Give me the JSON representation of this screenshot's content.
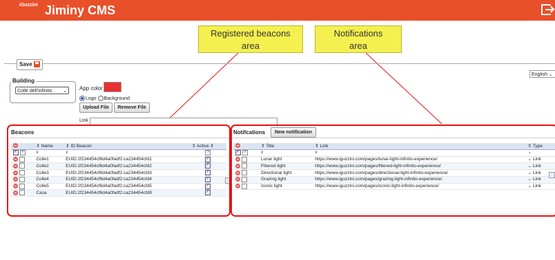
{
  "header": {
    "brand_small": "iGuzzini",
    "title": "Jiminy CMS",
    "exit_icon": "logout-icon"
  },
  "annotations": {
    "beacons_callout": [
      "Registered beacons",
      "area"
    ],
    "notifications_callout": [
      "Notifications",
      "area"
    ]
  },
  "toolbar": {
    "save_label": "Save"
  },
  "settings": {
    "building_legend": "Building",
    "building_selected": "Colle dell'infinito",
    "app_color_label": "App color",
    "app_color": "#e83030",
    "radio_logo": "Logo",
    "radio_background": "Background",
    "upload_label": "Upload File",
    "remove_label": "Remove File",
    "link_label": "Link",
    "language": "English"
  },
  "beacons": {
    "title": "Beacons",
    "columns": [
      "Name",
      "ID Beacon",
      "Active"
    ],
    "filter_x": "x",
    "rows": [
      {
        "name": "Colle1",
        "id": "EUID:2f234454cf6d4a0fadf2:ca234454cfd1"
      },
      {
        "name": "Colle2",
        "id": "EUID:2f234454cf6d4a0fadf2:ca234454cfd2"
      },
      {
        "name": "Colle3",
        "id": "EUID:2f234454cf6d4a0fadf2:ca234454cfd3"
      },
      {
        "name": "Colle4",
        "id": "EUID:2f234454cf6d4a0fadf2:ca234454cfd4"
      },
      {
        "name": "Colle5",
        "id": "EUID:2f234454cf6d4a0fadf2:ca234454cfd5"
      },
      {
        "name": "Casa",
        "id": "EUID:2f234454cf6d4a0fadf2:ca234454cfd9"
      }
    ]
  },
  "notifications": {
    "title": "Notifcations",
    "new_label": "New notification",
    "columns": [
      "Title",
      "Link",
      "Type"
    ],
    "filter_x": "x",
    "rows": [
      {
        "title": "Lunar light",
        "link": "https://www.iguzzini.com/pages/lunar-light-infinito-experience/",
        "type": "Link"
      },
      {
        "title": "Filtered light",
        "link": "https://www.iguzzini.com/pages/filtered-light-infinito-experience/",
        "type": "Link"
      },
      {
        "title": "Directional light",
        "link": "https://www.iguzzini.com/pages/directional-light-infinito-experience/",
        "type": "Link"
      },
      {
        "title": "Grazing light",
        "link": "https://www.iguzzini.com/pages/grazing-light-infinito-experience/",
        "type": "Link"
      },
      {
        "title": "Iconic light",
        "link": "https://www.iguzzini.com/pages/iconic-light-infinito-experience/",
        "type": "Link"
      }
    ]
  }
}
